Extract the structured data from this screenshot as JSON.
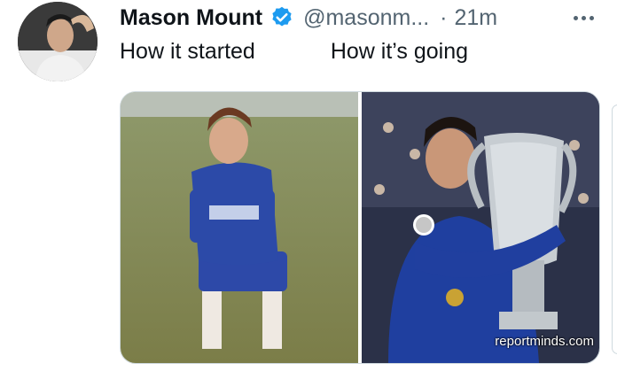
{
  "tweet": {
    "display_name": "Mason Mount",
    "handle": "@masonm...",
    "separator": "·",
    "time": "21m",
    "text_left": "How it started",
    "text_right": "How it’s going",
    "watermark": "reportminds.com"
  },
  "icons": {
    "verified": "verified-badge-icon",
    "more": "more-options-icon"
  },
  "colors": {
    "verified_blue": "#1d9bf0",
    "secondary_text": "#536471",
    "chelsea_blue": "#1f3f9f"
  }
}
